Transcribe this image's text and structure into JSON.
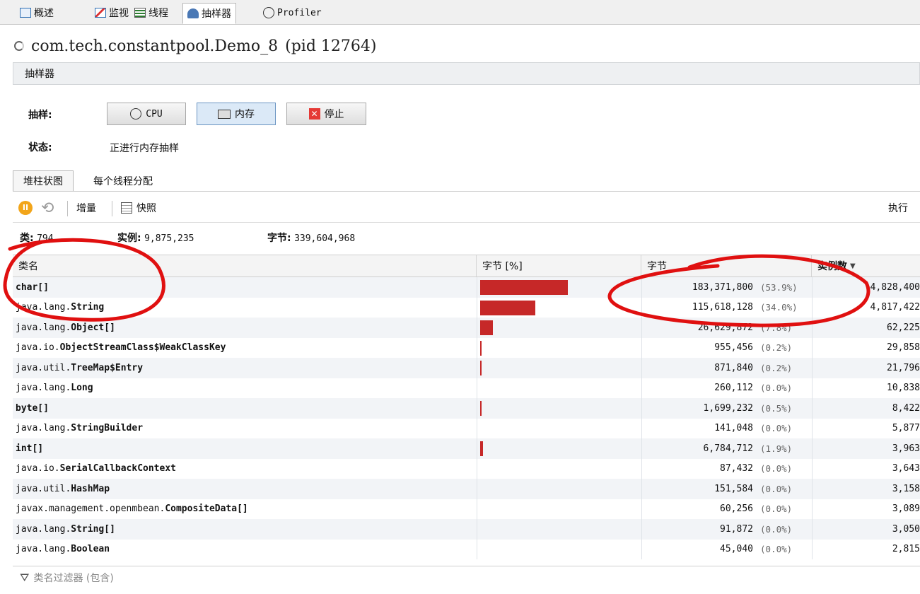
{
  "top_tabs": [
    {
      "label": "概述",
      "icon": "overview-icon"
    },
    {
      "label": "监视",
      "icon": "monitor-icon"
    },
    {
      "label": "线程",
      "icon": "threads-icon"
    },
    {
      "label": "抽样器",
      "icon": "sampler-icon",
      "active": true
    },
    {
      "label": "Profiler",
      "icon": "profiler-icon"
    }
  ],
  "title": "com.tech.constantpool.Demo_8",
  "pid": "(pid 12764)",
  "section": "抽样器",
  "sample": {
    "label": "抽样:",
    "cpu": "CPU",
    "memory": "内存",
    "stop": "停止"
  },
  "status": {
    "label": "状态:",
    "value": "正进行内存抽样"
  },
  "sub_tabs": [
    "堆柱状图",
    "每个线程分配"
  ],
  "toolbar": {
    "delta": "增量",
    "snapshot": "快照",
    "execute": "执行"
  },
  "stats": {
    "classes_label": "类:",
    "classes_value": "794",
    "instances_label": "实例:",
    "instances_value": "9,875,235",
    "bytes_label": "字节:",
    "bytes_value": "339,604,968"
  },
  "columns": {
    "name": "类名",
    "bytes_pct": "字节 [%]",
    "bytes": "字节",
    "instances": "实例数"
  },
  "rows": [
    {
      "prefix": "",
      "cls": "char[]",
      "bytes": "183,371,800",
      "pct": "(53.9%)",
      "frac": 0.539,
      "inst": "4,828,400"
    },
    {
      "prefix": "java.lang.",
      "cls": "String",
      "bytes": "115,618,128",
      "pct": "(34.0%)",
      "frac": 0.34,
      "inst": "4,817,422"
    },
    {
      "prefix": "java.lang.",
      "cls": "Object[]",
      "bytes": "26,629,872",
      "pct": "(7.8%)",
      "frac": 0.078,
      "inst": "62,225"
    },
    {
      "prefix": "java.io.",
      "cls": "ObjectStreamClass$WeakClassKey",
      "bytes": "955,456",
      "pct": "(0.2%)",
      "frac": 0.002,
      "inst": "29,858"
    },
    {
      "prefix": "java.util.",
      "cls": "TreeMap$Entry",
      "bytes": "871,840",
      "pct": "(0.2%)",
      "frac": 0.002,
      "inst": "21,796"
    },
    {
      "prefix": "java.lang.",
      "cls": "Long",
      "bytes": "260,112",
      "pct": "(0.0%)",
      "frac": 0.0,
      "inst": "10,838"
    },
    {
      "prefix": "",
      "cls": "byte[]",
      "bytes": "1,699,232",
      "pct": "(0.5%)",
      "frac": 0.005,
      "inst": "8,422"
    },
    {
      "prefix": "java.lang.",
      "cls": "StringBuilder",
      "bytes": "141,048",
      "pct": "(0.0%)",
      "frac": 0.0,
      "inst": "5,877"
    },
    {
      "prefix": "",
      "cls": "int[]",
      "bytes": "6,784,712",
      "pct": "(1.9%)",
      "frac": 0.019,
      "inst": "3,963"
    },
    {
      "prefix": "java.io.",
      "cls": "SerialCallbackContext",
      "bytes": "87,432",
      "pct": "(0.0%)",
      "frac": 0.0,
      "inst": "3,643"
    },
    {
      "prefix": "java.util.",
      "cls": "HashMap",
      "bytes": "151,584",
      "pct": "(0.0%)",
      "frac": 0.0,
      "inst": "3,158"
    },
    {
      "prefix": "javax.management.openmbean.",
      "cls": "CompositeData[]",
      "bytes": "60,256",
      "pct": "(0.0%)",
      "frac": 0.0,
      "inst": "3,089"
    },
    {
      "prefix": "java.lang.",
      "cls": "String[]",
      "bytes": "91,872",
      "pct": "(0.0%)",
      "frac": 0.0,
      "inst": "3,050"
    },
    {
      "prefix": "java.lang.",
      "cls": "Boolean",
      "bytes": "45,040",
      "pct": "(0.0%)",
      "frac": 0.0,
      "inst": "2,815"
    }
  ],
  "filter_placeholder": "类名过滤器 (包含)",
  "colors": {
    "bar": "#c62828",
    "annotation": "#e01010"
  }
}
